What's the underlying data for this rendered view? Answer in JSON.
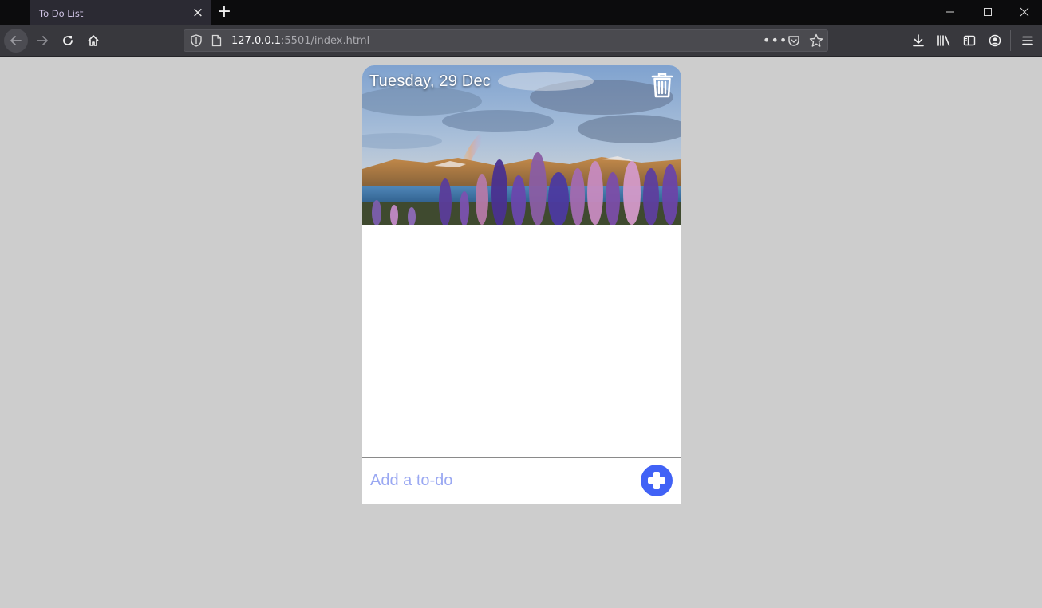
{
  "browser": {
    "tab_title": "To Do List",
    "url_host": "127.0.0.1",
    "url_rest": ":5501/index.html",
    "tab_close_glyph": "×",
    "new_tab_glyph": "+",
    "more_glyph": "•••"
  },
  "app": {
    "date_text": "Tuesday, 29 Dec",
    "input_placeholder": "Add a to-do",
    "input_value": "",
    "accent_color": "#4162f6",
    "todo_items": []
  },
  "icons": {
    "trash": "trash-icon",
    "add": "plus-circle-icon"
  }
}
